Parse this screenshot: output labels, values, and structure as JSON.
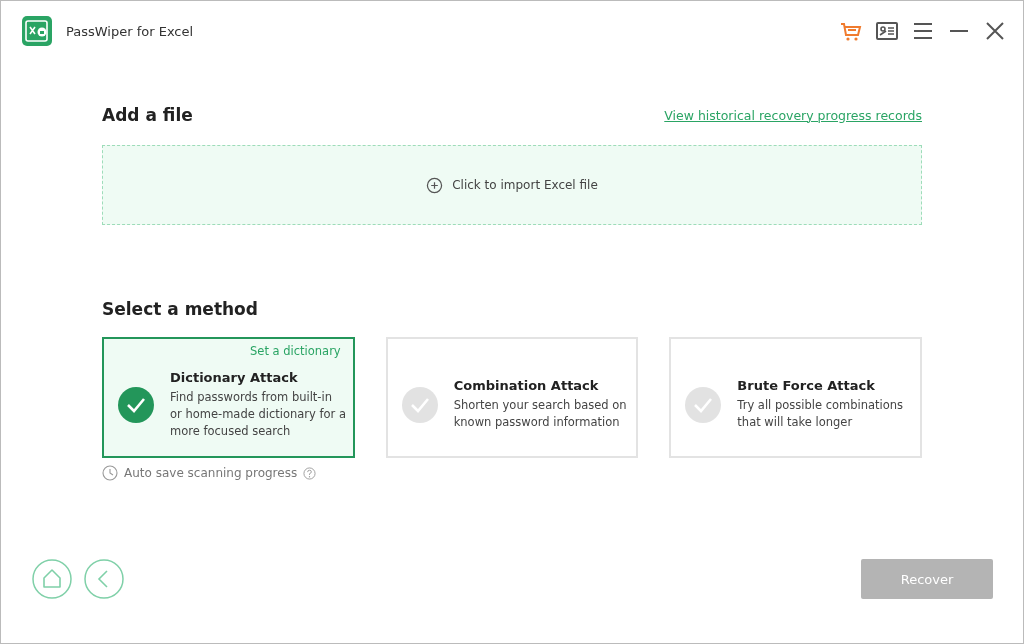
{
  "window": {
    "title": "PassWiper for Excel"
  },
  "add_file": {
    "heading": "Add a file",
    "history_link": "View historical recovery progress records",
    "import_label": "Click to import Excel file"
  },
  "method_section": {
    "heading": "Select a method",
    "methods": [
      {
        "title": "Dictionary Attack",
        "description": "Find passwords from built-in or home-made dictionary for a more focused search",
        "selected": true,
        "link": "Set a dictionary"
      },
      {
        "title": "Combination Attack",
        "description": "Shorten your search based on known password information",
        "selected": false
      },
      {
        "title": "Brute Force Attack",
        "description": "Try all possible combinations that will take longer",
        "selected": false
      }
    ],
    "auto_save": "Auto save scanning progress"
  },
  "recover_button": {
    "label": "Recover",
    "disabled": true
  }
}
